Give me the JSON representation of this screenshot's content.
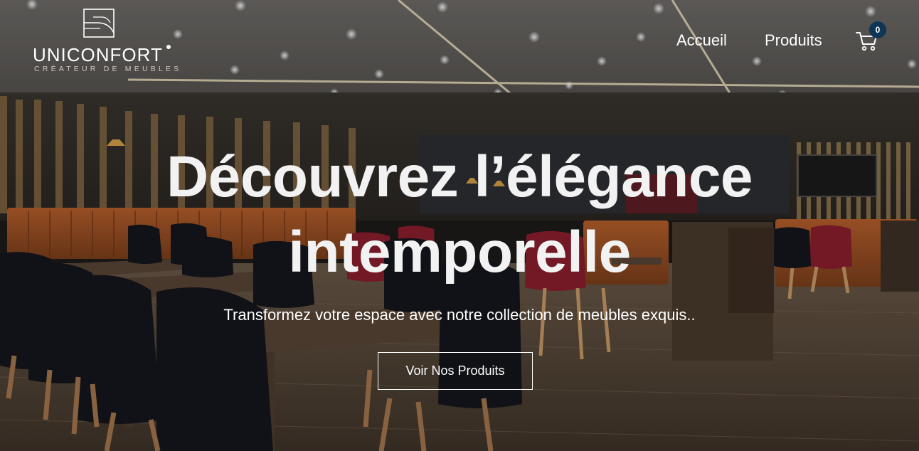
{
  "brand": {
    "name": "UNICONFORT",
    "tagline": "CRÉATEUR DE MEUBLES"
  },
  "nav": {
    "items": [
      {
        "label": "Accueil"
      },
      {
        "label": "Produits"
      }
    ],
    "cart": {
      "icon": "cart-icon",
      "count": "0"
    }
  },
  "hero": {
    "title_line1": "Découvrez l’élégance",
    "title_line2": "intemporelle",
    "subtitle": "Transformez votre espace avec notre collection de meubles exquis..",
    "cta_label": "Voir Nos Produits"
  },
  "colors": {
    "badge": "#0f3554",
    "text": "#ffffff",
    "chair_red": "#8c1f2e",
    "bench_orange": "#b8602c"
  }
}
